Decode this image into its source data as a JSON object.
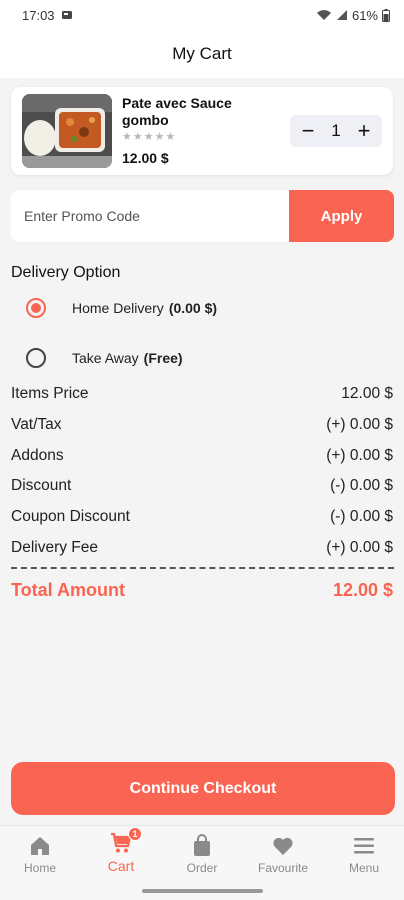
{
  "status_bar": {
    "time": "17:03",
    "battery": "61%"
  },
  "header": {
    "title": "My Cart"
  },
  "cart_item": {
    "name": "Pate avec Sauce gombo",
    "stars": "★★★★★",
    "price": "12.00 $",
    "quantity": "1",
    "minus": "−",
    "plus": "+"
  },
  "promo": {
    "placeholder": "Enter Promo Code",
    "apply_label": "Apply"
  },
  "delivery": {
    "title": "Delivery Option",
    "options": [
      {
        "label": "Home Delivery",
        "extra": "(0.00 $)",
        "selected": true
      },
      {
        "label": "Take Away",
        "extra": "(Free)",
        "selected": false
      }
    ]
  },
  "summary": {
    "rows": [
      {
        "label": "Items Price",
        "value": "12.00 $"
      },
      {
        "label": "Vat/Tax",
        "value": "(+) 0.00 $"
      },
      {
        "label": "Addons",
        "value": "(+) 0.00 $"
      },
      {
        "label": "Discount",
        "value": "(-) 0.00 $"
      },
      {
        "label": "Coupon Discount",
        "value": "(-) 0.00 $"
      },
      {
        "label": "Delivery Fee",
        "value": "(+) 0.00 $"
      }
    ],
    "total_label": "Total Amount",
    "total_value": "12.00 $"
  },
  "checkout": {
    "label": "Continue Checkout"
  },
  "bottom_nav": {
    "items": [
      {
        "label": "Home",
        "icon": "home-icon"
      },
      {
        "label": "Cart",
        "icon": "cart-icon",
        "badge": "1"
      },
      {
        "label": "Order",
        "icon": "bag-icon"
      },
      {
        "label": "Favourite",
        "icon": "heart-icon"
      },
      {
        "label": "Menu",
        "icon": "menu-icon"
      }
    ]
  },
  "colors": {
    "accent": "#fa6452",
    "background": "#f4f4f4",
    "card": "#ffffff"
  }
}
